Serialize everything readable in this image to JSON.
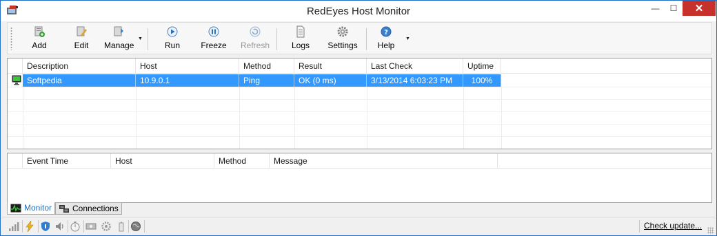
{
  "window": {
    "title": "RedEyes Host Monitor",
    "controls": {
      "minimize": "—",
      "maximize": "☐",
      "close": "✕"
    }
  },
  "toolbar": {
    "buttons": [
      {
        "label": "Add",
        "icon": "add-host-icon",
        "enabled": true
      },
      {
        "label": "Edit",
        "icon": "edit-host-icon",
        "enabled": true
      },
      {
        "label": "Manage",
        "icon": "manage-icon",
        "enabled": true
      },
      {
        "label": "Run",
        "icon": "run-icon",
        "enabled": true
      },
      {
        "label": "Freeze",
        "icon": "freeze-icon",
        "enabled": true
      },
      {
        "label": "Refresh",
        "icon": "refresh-icon",
        "enabled": false
      },
      {
        "label": "Logs",
        "icon": "logs-icon",
        "enabled": true
      },
      {
        "label": "Settings",
        "icon": "settings-icon",
        "enabled": true
      },
      {
        "label": "Help",
        "icon": "help-icon",
        "enabled": true
      }
    ]
  },
  "hosts_table": {
    "columns": [
      "Description",
      "Host",
      "Method",
      "Result",
      "Last Check",
      "Uptime"
    ],
    "rows": [
      {
        "description": "Softpedia",
        "host": "10.9.0.1",
        "method": "Ping",
        "result": "OK (0 ms)",
        "last_check": "3/13/2014 6:03:23 PM",
        "uptime": "100%",
        "selected": true,
        "status_icon": "monitor-ok-icon"
      }
    ]
  },
  "events_table": {
    "columns": [
      "Event Time",
      "Host",
      "Method",
      "Message"
    ],
    "rows": []
  },
  "tabs": [
    {
      "label": "Monitor",
      "icon": "monitor-graph-icon",
      "active": true
    },
    {
      "label": "Connections",
      "icon": "connections-icon",
      "active": false
    }
  ],
  "statusbar": {
    "icons": [
      "signal-bars-icon",
      "lightning-icon",
      "shield-icon",
      "speaker-icon",
      "stopwatch-icon",
      "money-icon",
      "gear-icon",
      "battery-icon",
      "globe-icon"
    ],
    "check_update_label": "Check update..."
  },
  "colors": {
    "selection": "#3399ff",
    "close_button": "#c7312b",
    "active_tab_text": "#1b6ec2",
    "window_border": "#1e6fc5"
  }
}
